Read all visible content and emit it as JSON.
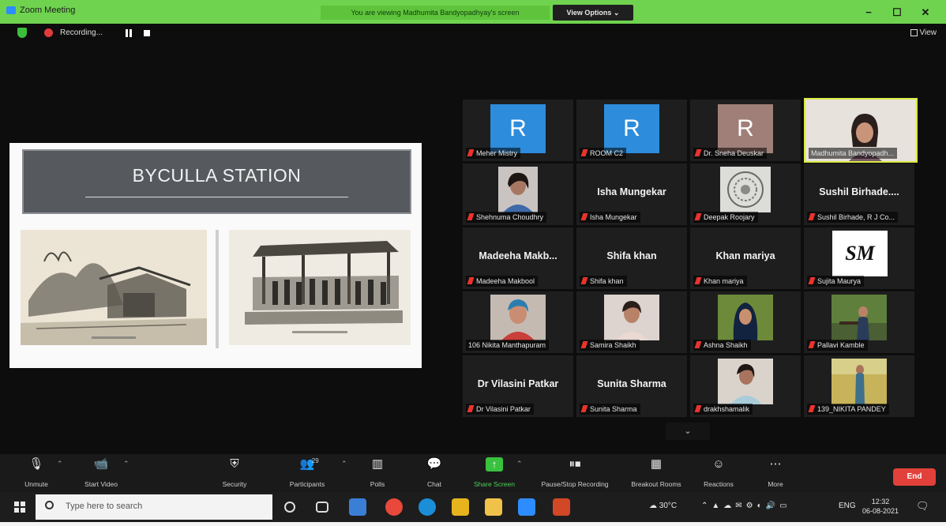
{
  "window": {
    "title": "Zoom Meeting",
    "viewing_banner": "You are viewing Madhumita Bandyopadhyay's screen",
    "view_options": "View Options ⌄",
    "minimize": "−",
    "maximize": "☐",
    "close": "✕"
  },
  "recording": {
    "label": "Recording...",
    "view_button": "View"
  },
  "slide": {
    "title": "BYCULLA STATION"
  },
  "participants": [
    {
      "name": "Meher Mistry",
      "initial": "R",
      "color": "#2d8cdc",
      "type": "letter"
    },
    {
      "name": "ROOM C2",
      "initial": "R",
      "color": "#2d8cdc",
      "type": "letter"
    },
    {
      "name": "Dr. Sneha Deuskar",
      "initial": "R",
      "color": "#a07f78",
      "type": "letter"
    },
    {
      "name": "Madhumita Bandyopadh...",
      "type": "photo",
      "active": true
    },
    {
      "name": "Shehnuma Choudhry",
      "type": "photo"
    },
    {
      "name": "Isha Mungekar",
      "display": "Isha Mungekar",
      "type": "name"
    },
    {
      "name": "Deepak Roojary",
      "type": "photo"
    },
    {
      "name": "Sushil Birhade, R J Co...",
      "display": "Sushil Birhade....",
      "type": "name"
    },
    {
      "name": "Madeeha Makbool",
      "display": "Madeeha Makb...",
      "type": "name"
    },
    {
      "name": "Shifa khan",
      "display": "Shifa khan",
      "type": "name"
    },
    {
      "name": "Khan mariya",
      "display": "Khan mariya",
      "type": "name"
    },
    {
      "name": "Sujita Maurya",
      "display": "SM",
      "type": "logo"
    },
    {
      "name": "106 Nikita Manthapuram",
      "type": "photo"
    },
    {
      "name": "Samira Shaikh",
      "type": "photo"
    },
    {
      "name": "Ashna Shaikh",
      "type": "photo"
    },
    {
      "name": "Pallavi Kamble",
      "type": "photo"
    },
    {
      "name": "Dr Vilasini Patkar",
      "display": "Dr Vilasini Patkar",
      "type": "name"
    },
    {
      "name": "Sunita Sharma",
      "display": "Sunita Sharma",
      "type": "name"
    },
    {
      "name": "drakhshamalik",
      "type": "photo"
    },
    {
      "name": "139_NIKITA PANDEY",
      "type": "photo"
    }
  ],
  "toolbar": {
    "unmute": "Unmute",
    "start_video": "Start Video",
    "security": "Security",
    "participants": "Participants",
    "participants_count": "29",
    "polls": "Polls",
    "chat": "Chat",
    "share_screen": "Share Screen",
    "record": "Pause/Stop Recording",
    "breakout": "Breakout Rooms",
    "reactions": "Reactions",
    "more": "More",
    "end": "End"
  },
  "taskbar": {
    "search_placeholder": "Type here to search",
    "weather": "30°C",
    "language": "ENG",
    "time": "12:32",
    "date": "06-08-2021"
  },
  "colors": {
    "titlebar": "#6fd34f",
    "end_button": "#e2403b",
    "active_speaker": "#d9ea3f",
    "muted_mic": "#e8342c"
  }
}
